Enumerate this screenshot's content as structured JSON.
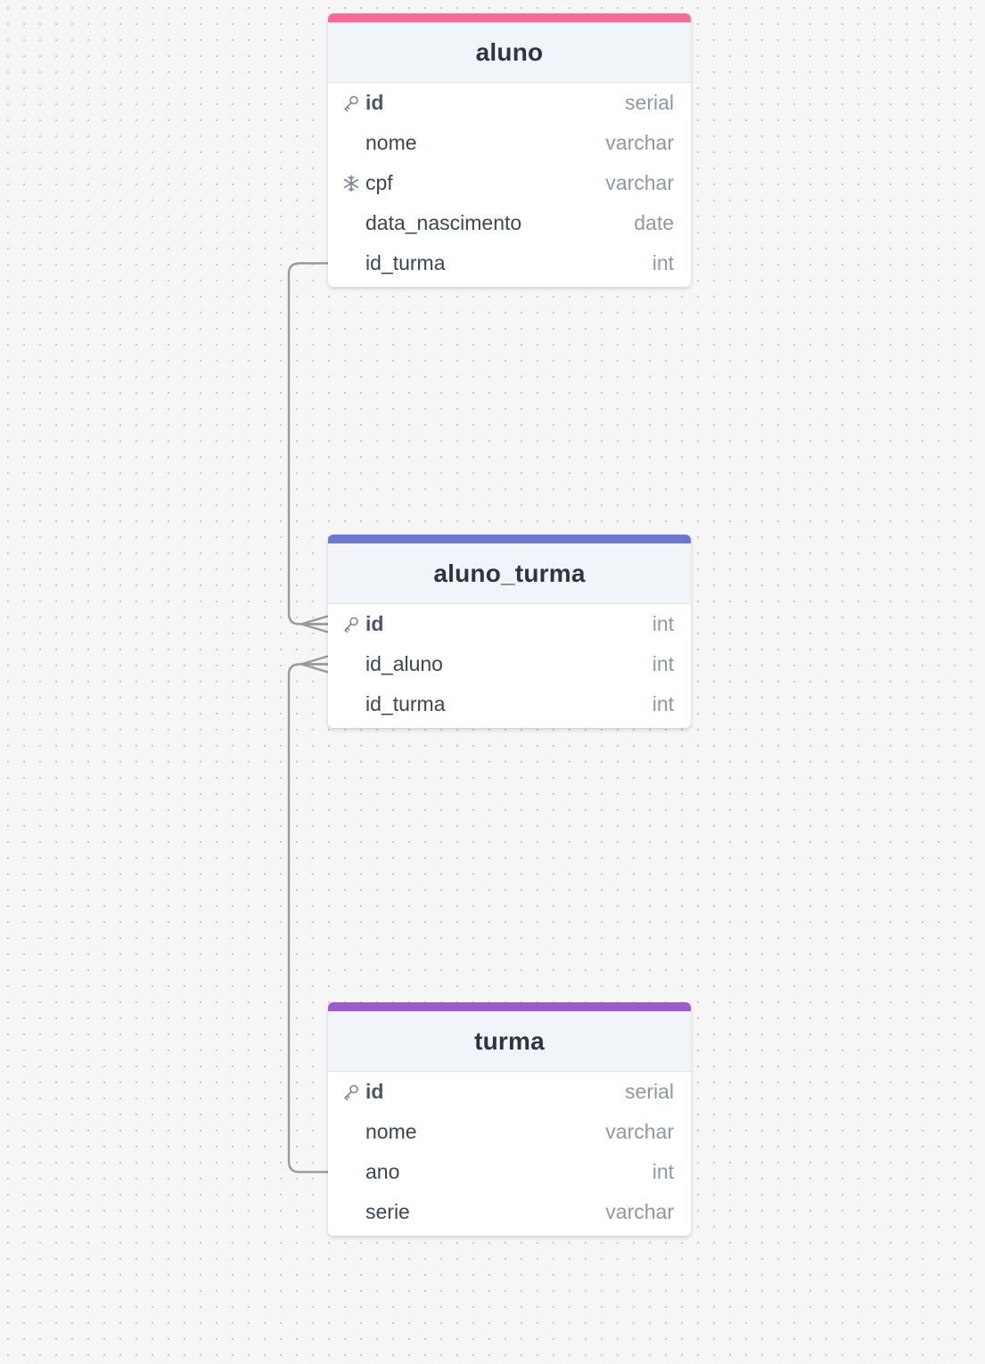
{
  "diagram": {
    "tables": [
      {
        "id": "aluno",
        "name": "aluno",
        "color": "#f76b96",
        "fields": [
          {
            "name": "id",
            "type": "serial",
            "icon": "key-icon",
            "primary": true
          },
          {
            "name": "nome",
            "type": "varchar",
            "icon": "",
            "primary": false
          },
          {
            "name": "cpf",
            "type": "varchar",
            "icon": "snowflake-icon",
            "primary": false
          },
          {
            "name": "data_nascimento",
            "type": "date",
            "icon": "",
            "primary": false
          },
          {
            "name": "id_turma",
            "type": "int",
            "icon": "",
            "primary": false
          }
        ]
      },
      {
        "id": "aluno_turma",
        "name": "aluno_turma",
        "color": "#6b77d0",
        "fields": [
          {
            "name": "id",
            "type": "int",
            "icon": "key-icon",
            "primary": true
          },
          {
            "name": "id_aluno",
            "type": "int",
            "icon": "",
            "primary": false
          },
          {
            "name": "id_turma",
            "type": "int",
            "icon": "",
            "primary": false
          }
        ]
      },
      {
        "id": "turma",
        "name": "turma",
        "color": "#9b59d6",
        "fields": [
          {
            "name": "id",
            "type": "serial",
            "icon": "key-icon",
            "primary": true
          },
          {
            "name": "nome",
            "type": "varchar",
            "icon": "",
            "primary": false
          },
          {
            "name": "ano",
            "type": "int",
            "icon": "",
            "primary": false
          },
          {
            "name": "serie",
            "type": "varchar",
            "icon": "",
            "primary": false
          }
        ]
      }
    ],
    "relationships": [
      {
        "from_table": "aluno",
        "from_field": "id_turma",
        "to_table": "aluno_turma",
        "to_field": "id",
        "to_cardinality": "many"
      },
      {
        "from_table": "turma",
        "from_field": "ano",
        "to_table": "aluno_turma",
        "to_field": "id_aluno",
        "to_cardinality": "many"
      }
    ],
    "line_color": "#9a9a9a"
  }
}
